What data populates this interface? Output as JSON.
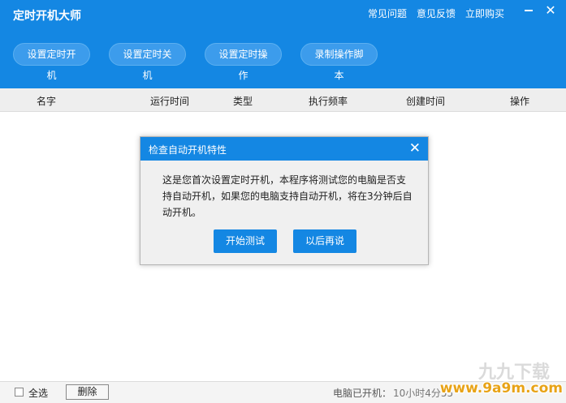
{
  "app": {
    "title": "定时开机大师",
    "top_links": [
      "常见问题",
      "意见反馈",
      "立即购买"
    ],
    "window_controls": {
      "minimize_icon": "minimize-icon",
      "close_icon": "close-icon",
      "close_glyph": "✕"
    }
  },
  "toolbar": {
    "buttons": [
      "设置定时开机",
      "设置定时关机",
      "设置定时操作",
      "录制操作脚本"
    ]
  },
  "table": {
    "columns": [
      "名字",
      "运行时间",
      "类型",
      "执行频率",
      "创建时间",
      "操作"
    ]
  },
  "footer": {
    "select_all": "全选",
    "delete": "删除",
    "uptime_label": "电脑已开机：",
    "uptime_value": "10小时4分55"
  },
  "dialog": {
    "title": "检查自动开机特性",
    "close_glyph": "✕",
    "message": "这是您首次设置定时开机，本程序将测试您的电脑是否支持自动开机，如果您的电脑支持自动开机，将在3分钟后自动开机。",
    "start_test": "开始测试",
    "later": "以后再说"
  },
  "watermark": {
    "text": "www.9a9m.com",
    "back_text": "九九下载"
  },
  "colors": {
    "accent": "#1487e3",
    "watermark": "#e8a317"
  }
}
